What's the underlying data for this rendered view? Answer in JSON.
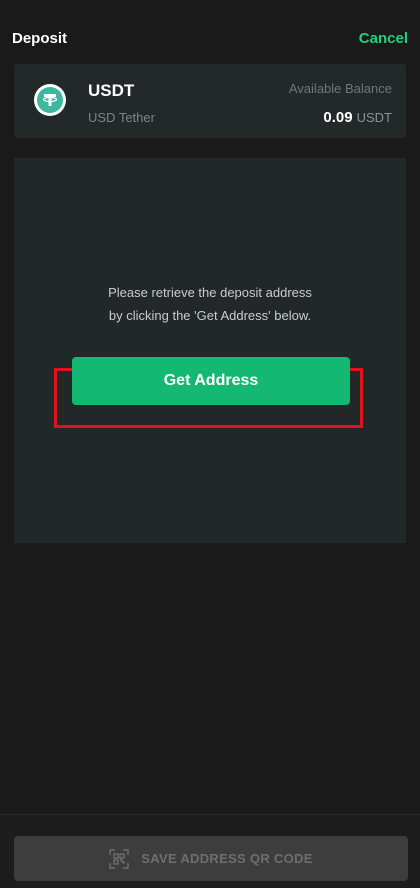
{
  "header": {
    "title": "Deposit",
    "cancel_label": "Cancel"
  },
  "asset": {
    "symbol": "USDT",
    "name": "USD Tether",
    "balance_label": "Available Balance",
    "balance_value": "0.09",
    "balance_unit": "USDT",
    "icon": "tether-icon"
  },
  "panel": {
    "instruction_line1": "Please retrieve the deposit address",
    "instruction_line2": "by clicking the 'Get Address' below.",
    "get_address_label": "Get Address"
  },
  "footer": {
    "save_qr_label": "SAVE ADDRESS QR CODE",
    "icon": "qr-scan-icon"
  },
  "colors": {
    "accent": "#1fd17a",
    "button": "#15b872",
    "highlight": "#e0121b"
  }
}
